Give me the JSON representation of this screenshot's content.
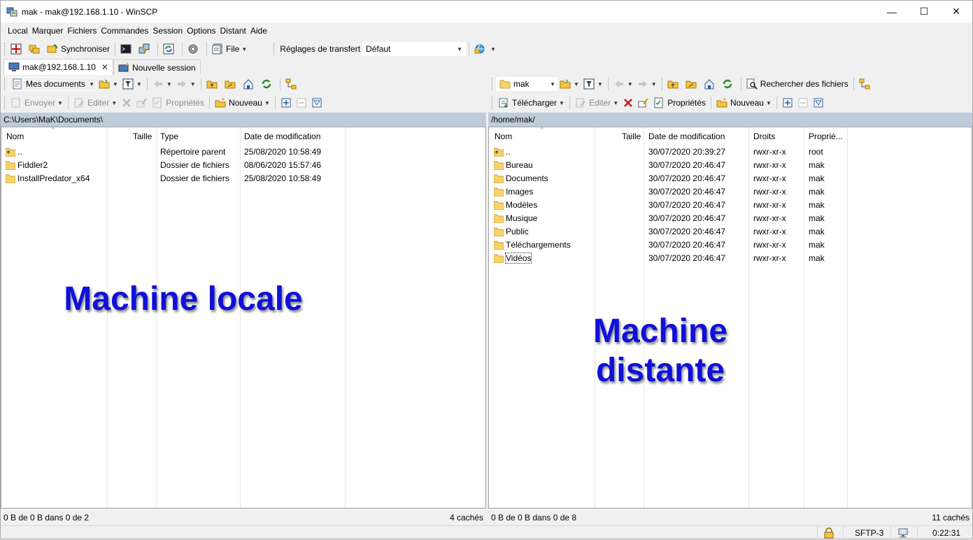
{
  "window": {
    "title": "mak - mak@192.168.1.10 - WinSCP",
    "min": "—",
    "max": "☐",
    "close": "✕"
  },
  "menu": [
    "Local",
    "Marquer",
    "Fichiers",
    "Commandes",
    "Session",
    "Options",
    "Distant",
    "Aide"
  ],
  "toolbar": {
    "sync_label": "Synchroniser",
    "file_label": "File",
    "transfer_settings_label": "Réglages de transfert",
    "transfer_settings_value": "Défaut"
  },
  "tabs": [
    {
      "label": "mak@192.168.1.10",
      "close": "✕"
    },
    {
      "label": "Nouvelle session"
    }
  ],
  "local": {
    "location": "Mes documents",
    "actions": {
      "send": "Envoyer",
      "edit": "Editer",
      "props": "Propriétés",
      "new": "Nouveau"
    },
    "path": "C:\\Users\\MaK\\Documents\\",
    "columns": [
      "Nom",
      "Taille",
      "Type",
      "Date de modification"
    ],
    "rows": [
      {
        "name": "..",
        "size": "",
        "type": "Répertoire parent",
        "date": "25/08/2020  10:58:49",
        "parent": true
      },
      {
        "name": "Fiddler2",
        "size": "",
        "type": "Dossier de fichiers",
        "date": "08/06/2020  15:57:46"
      },
      {
        "name": "InstallPredator_x64",
        "size": "",
        "type": "Dossier de fichiers",
        "date": "25/08/2020  10:58:49"
      }
    ],
    "status_left": "0 B de 0 B dans 0 de 2",
    "status_right": "4 cachés",
    "overlay": "Machine locale"
  },
  "remote": {
    "location": "mak",
    "search_label": "Rechercher des fichiers",
    "actions": {
      "download": "Télécharger",
      "edit": "Editer",
      "props": "Propriétés",
      "new": "Nouveau"
    },
    "path": "/home/mak/",
    "columns": [
      "Nom",
      "Taille",
      "Date de modification",
      "Droits",
      "Proprié..."
    ],
    "rows": [
      {
        "name": "..",
        "size": "",
        "date": "30/07/2020 20:39:27",
        "rights": "rwxr-xr-x",
        "owner": "root",
        "parent": true
      },
      {
        "name": "Bureau",
        "size": "",
        "date": "30/07/2020 20:46:47",
        "rights": "rwxr-xr-x",
        "owner": "mak"
      },
      {
        "name": "Documents",
        "size": "",
        "date": "30/07/2020 20:46:47",
        "rights": "rwxr-xr-x",
        "owner": "mak"
      },
      {
        "name": "Images",
        "size": "",
        "date": "30/07/2020 20:46:47",
        "rights": "rwxr-xr-x",
        "owner": "mak"
      },
      {
        "name": "Modèles",
        "size": "",
        "date": "30/07/2020 20:46:47",
        "rights": "rwxr-xr-x",
        "owner": "mak"
      },
      {
        "name": "Musique",
        "size": "",
        "date": "30/07/2020 20:46:47",
        "rights": "rwxr-xr-x",
        "owner": "mak"
      },
      {
        "name": "Public",
        "size": "",
        "date": "30/07/2020 20:46:47",
        "rights": "rwxr-xr-x",
        "owner": "mak"
      },
      {
        "name": "Téléchargements",
        "size": "",
        "date": "30/07/2020 20:46:47",
        "rights": "rwxr-xr-x",
        "owner": "mak"
      },
      {
        "name": "Vidéos",
        "size": "",
        "date": "30/07/2020 20:46:47",
        "rights": "rwxr-xr-x",
        "owner": "mak",
        "focused": true
      }
    ],
    "status_left": "0 B de 0 B dans 0 de 8",
    "status_right": "11 cachés",
    "overlay_line1": "Machine",
    "overlay_line2": "distante"
  },
  "bottom": {
    "protocol": "SFTP-3",
    "elapsed": "0:22:31"
  },
  "colors": {
    "overlay_text": "#1010d8",
    "path_bar": "#bfcddb",
    "folder": "#f6d36b"
  }
}
